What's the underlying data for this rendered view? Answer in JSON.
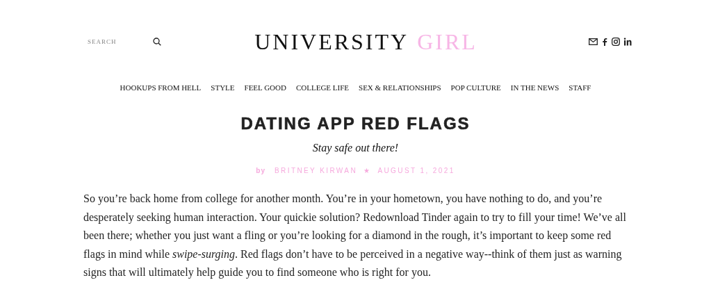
{
  "header": {
    "search": {
      "placeholder": "SEARCH"
    },
    "logo": {
      "first": "UNIVERSITY",
      "second": "GIRL"
    }
  },
  "nav": [
    "HOOKUPS FROM HELL",
    "STYLE",
    "FEEL GOOD",
    "COLLEGE LIFE",
    "SEX & RELATIONSHIPS",
    "POP CULTURE",
    "IN THE NEWS",
    "STAFF"
  ],
  "article": {
    "title": "DATING APP RED FLAGS",
    "subtitle": "Stay safe out there!",
    "byline": {
      "prefix": "by",
      "author": "BRITNEY KIRWAN",
      "separator": "★",
      "date": "AUGUST 1, 2021"
    },
    "body": "So you’re back home from college for another month. You’re in your hometown, you have nothing to do, and you’re desperately seeking human interaction. Your quickie solution? Redownload Tinder again to try to fill your time! We’ve all been there; whether you just want a fling or you’re looking for a diamond in the rough, it’s important to keep some red flags in mind while *swipe-surging*. Red flags don’t have to be perceived in a negative way--think of them just as warning signs that will ultimately help guide you to find someone who is right for you."
  }
}
